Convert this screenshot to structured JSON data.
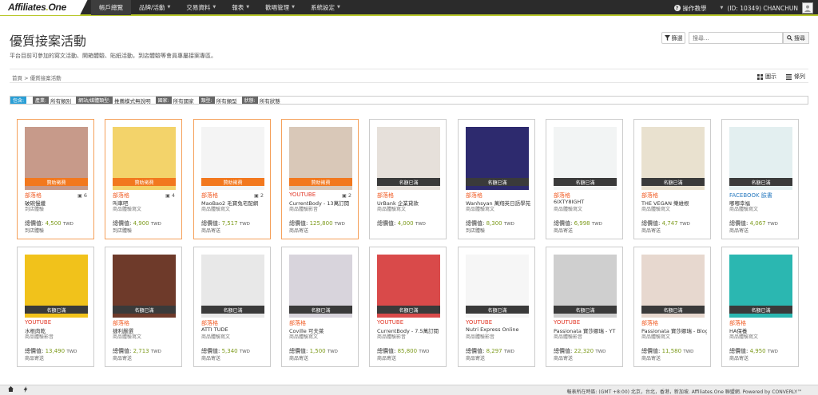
{
  "brand": {
    "logo_main": "Affiliates",
    "logo_dot": ".",
    "logo_tail": "One"
  },
  "nav": [
    "帳戶總覽",
    "品牌/活動",
    "交易資料",
    "報表",
    "歡唱管理",
    "系統設定"
  ],
  "nav_right": {
    "help": "操作教學",
    "user": "(ID: 10349) CHANCHUN"
  },
  "page": {
    "title": "優質接案活動",
    "subtitle": "平台目前可參加的寫文活動、開箱體驗、貼紙活動，到店體驗等會員專屬接案專區。",
    "filter_label": "篩選",
    "search_placeholder": "搜尋...",
    "search_label": "搜尋",
    "breadcrumb": "首頁 > 優質接案活動",
    "view_grid": "圖示",
    "view_list": "條列"
  },
  "filters": [
    {
      "label": "包含:",
      "value": "",
      "style": "blue"
    },
    {
      "label": "產業:",
      "value": "所有類別",
      "style": "gray"
    },
    {
      "label": "網站/媒體類型:",
      "value": "推薦模式無說明",
      "style": "gray"
    },
    {
      "label": "國家:",
      "value": "所有國家",
      "style": "gray"
    },
    {
      "label": "類型:",
      "value": "所有類型",
      "style": "gray"
    },
    {
      "label": "狀態:",
      "value": "所有狀態",
      "style": "gray"
    }
  ],
  "price_label": "總價值:",
  "currency": "TWD",
  "cards": [
    {
      "banner": "贊助徵費",
      "banner_style": "orange",
      "category": "部落格",
      "cat_style": "orange",
      "count": "6",
      "name": "破碗慢纖",
      "type": "到店體驗",
      "price": "4,500",
      "kind": "到店體驗",
      "highlight": true,
      "bg": "#c79a8a"
    },
    {
      "banner": "贊助徵費",
      "banner_style": "orange",
      "category": "部落格",
      "cat_style": "orange",
      "count": "4",
      "name": "叫車吧",
      "type": "商品體驗寫文",
      "price": "4,900",
      "kind": "到店體驗",
      "highlight": true,
      "bg": "#f3d36a"
    },
    {
      "banner": "贊助徵費",
      "banner_style": "orange",
      "category": "部落格",
      "cat_style": "orange",
      "count": "2",
      "name": "MaoBao2 毛寶兔宅配網",
      "type": "商品體驗寫文",
      "price": "7,517",
      "kind": "商品寄送",
      "highlight": true,
      "bg": "#f4f4f4"
    },
    {
      "banner": "贊助徵費",
      "banner_style": "orange",
      "category": "YOUTUBE",
      "cat_style": "red",
      "count": "2",
      "name": "CurrentBody - 13萬訂閱",
      "type": "商品體驗影音",
      "price": "125,800",
      "kind": "商品寄送",
      "highlight": true,
      "bg": "#d9c8b8"
    },
    {
      "banner": "名額已滿",
      "banner_style": "dark",
      "category": "部落格",
      "cat_style": "orange",
      "count": "",
      "name": "UrBank 企業貸款",
      "type": "商品體驗寫文",
      "price": "4,000",
      "kind": "",
      "highlight": false,
      "bg": "#e6e0da"
    },
    {
      "banner": "名額已滿",
      "banner_style": "dark",
      "category": "部落格",
      "cat_style": "orange",
      "count": "",
      "name": "Wanhsyan 萬翔英日語學苑",
      "type": "商品體驗寫文",
      "price": "8,300",
      "kind": "到店體驗",
      "highlight": false,
      "bg": "#2d2a6e"
    },
    {
      "banner": "名額已滿",
      "banner_style": "dark",
      "category": "部落格",
      "cat_style": "orange",
      "count": "",
      "name": "6IXTY8IGHT",
      "type": "商品體驗寫文",
      "price": "6,998",
      "kind": "商品寄送",
      "highlight": false,
      "bg": "#f2f4f4"
    },
    {
      "banner": "名額已滿",
      "banner_style": "dark",
      "category": "部落格",
      "cat_style": "orange",
      "count": "",
      "name": "THE VEGAN 樂維根",
      "type": "商品體驗寫文",
      "price": "4,747",
      "kind": "商品寄送",
      "highlight": false,
      "bg": "#e9e1cf"
    },
    {
      "banner": "名額已滿",
      "banner_style": "dark",
      "category": "FACEBOOK 臉書",
      "cat_style": "blue",
      "count": "",
      "name": "嘟嘟幸福",
      "type": "商品體驗寫文",
      "price": "4,067",
      "kind": "商品寄送",
      "highlight": false,
      "bg": "#e3eff0"
    },
    {
      "banner": "名額已滿",
      "banner_style": "dark",
      "category": "YOUTUBE",
      "cat_style": "red",
      "count": "",
      "name": "水根肉乾",
      "type": "商品體驗影音",
      "price": "13,490",
      "kind": "商品寄送",
      "highlight": false,
      "bg": "#f1c21b"
    },
    {
      "banner": "名額已滿",
      "banner_style": "dark",
      "category": "部落格",
      "cat_style": "orange",
      "count": "",
      "name": "捷利嚴選",
      "type": "商品體驗寫文",
      "price": "2,713",
      "kind": "商品寄送",
      "highlight": false,
      "bg": "#6e3a2a"
    },
    {
      "banner": "名額已滿",
      "banner_style": "dark",
      "category": "部落格",
      "cat_style": "orange",
      "count": "",
      "name": "ATTI TUDE",
      "type": "商品體驗寫文",
      "price": "5,340",
      "kind": "商品寄送",
      "highlight": false,
      "bg": "#e8e8e8"
    },
    {
      "banner": "名額已滿",
      "banner_style": "dark",
      "category": "部落格",
      "cat_style": "orange",
      "count": "",
      "name": "Coville 可夫萊",
      "type": "商品體驗寫文",
      "price": "1,500",
      "kind": "商品寄送",
      "highlight": false,
      "bg": "#d8d4dc"
    },
    {
      "banner": "名額已滿",
      "banner_style": "dark",
      "category": "YOUTUBE",
      "cat_style": "red",
      "count": "",
      "name": "CurrentBody - 7.5萬訂閱",
      "type": "商品體驗影音",
      "price": "85,800",
      "kind": "商品寄送",
      "highlight": false,
      "bg": "#d94a4a"
    },
    {
      "banner": "名額已滿",
      "banner_style": "dark",
      "category": "YOUTUBE",
      "cat_style": "red",
      "count": "",
      "name": "Nutri Express Online",
      "type": "商品體驗影音",
      "price": "8,297",
      "kind": "商品寄送",
      "highlight": false,
      "bg": "#f6f6f6"
    },
    {
      "banner": "名額已滿",
      "banner_style": "dark",
      "category": "YOUTUBE",
      "cat_style": "red",
      "count": "",
      "name": "Passionata 寶莎娜瑞 - YT",
      "type": "商品體驗影音",
      "price": "22,320",
      "kind": "商品寄送",
      "highlight": false,
      "bg": "#cfcfcf"
    },
    {
      "banner": "名額已滿",
      "banner_style": "dark",
      "category": "部落格",
      "cat_style": "orange",
      "count": "",
      "name": "Passionata 寶莎娜瑞 - Blog",
      "type": "商品體驗寫文",
      "price": "11,580",
      "kind": "商品寄送",
      "highlight": false,
      "bg": "#e7d8cf"
    },
    {
      "banner": "名額已滿",
      "banner_style": "dark",
      "category": "部落格",
      "cat_style": "orange",
      "count": "",
      "name": "HA保養",
      "type": "商品體驗寫文",
      "price": "4,950",
      "kind": "商品寄送",
      "highlight": false,
      "bg": "#2bb7b1"
    }
  ],
  "footer": "報表所在時區: (GMT +8:00) 北京，台北，香港，新加坡. Affiliates.One 聯盟網. Powered by CONVERLY™"
}
